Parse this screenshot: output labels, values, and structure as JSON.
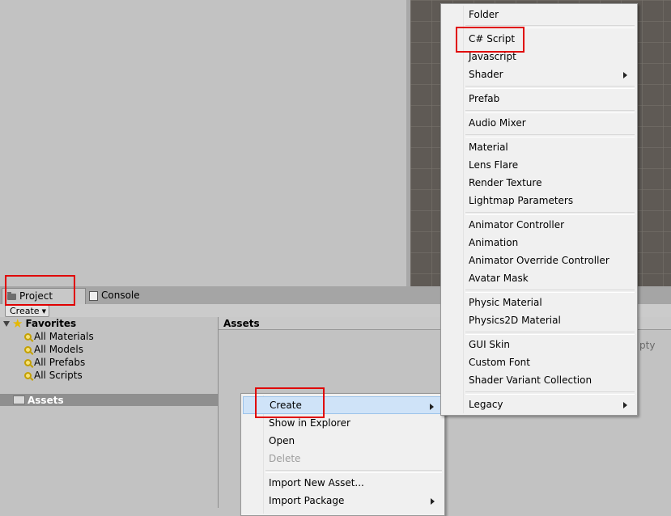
{
  "tabs": [
    {
      "label": "Project",
      "icon": "folder-icon"
    },
    {
      "label": "Console",
      "icon": "console-icon"
    }
  ],
  "toolbar": {
    "create_label": "Create",
    "caret": "▼"
  },
  "favorites": {
    "label": "Favorites",
    "items": [
      "All Materials",
      "All Models",
      "All Prefabs",
      "All Scripts"
    ]
  },
  "assets": {
    "tree_label": "Assets",
    "header": "Assets",
    "empty_text": "pty"
  },
  "context_menu": {
    "items": [
      {
        "label": "Create",
        "submenu": true,
        "highlighted": true
      },
      {
        "label": "Show in Explorer"
      },
      {
        "label": "Open"
      },
      {
        "label": "Delete",
        "disabled": true
      },
      {
        "label": "Import New Asset..."
      },
      {
        "label": "Import Package",
        "submenu": true
      }
    ]
  },
  "create_menu": {
    "items": [
      {
        "label": "Folder"
      },
      {
        "label": "C# Script"
      },
      {
        "label": "Javascript"
      },
      {
        "label": "Shader",
        "submenu": true
      },
      {
        "label": "Prefab"
      },
      {
        "label": "Audio Mixer"
      },
      {
        "label": "Material"
      },
      {
        "label": "Lens Flare"
      },
      {
        "label": "Render Texture"
      },
      {
        "label": "Lightmap Parameters"
      },
      {
        "label": "Animator Controller"
      },
      {
        "label": "Animation"
      },
      {
        "label": "Animator Override Controller"
      },
      {
        "label": "Avatar Mask"
      },
      {
        "label": "Physic Material"
      },
      {
        "label": "Physics2D Material"
      },
      {
        "label": "GUI Skin"
      },
      {
        "label": "Custom Font"
      },
      {
        "label": "Shader Variant Collection"
      },
      {
        "label": "Legacy",
        "submenu": true
      }
    ]
  },
  "colors": {
    "annotation": "#e00000",
    "scene_bg": "#5f5a55",
    "panel_bg": "#c2c2c2",
    "menu_bg": "#f0f0f0"
  }
}
